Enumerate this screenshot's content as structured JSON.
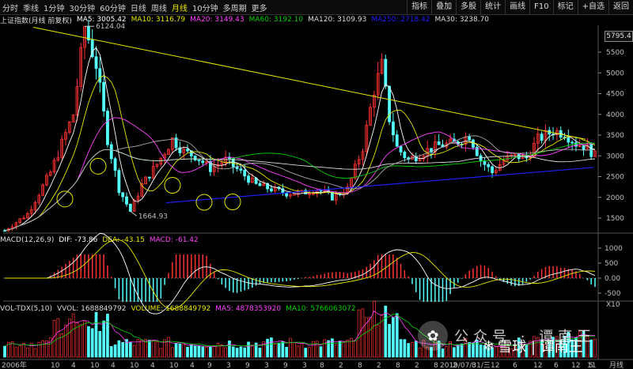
{
  "toolbar": {
    "periods": [
      "分时",
      "季线",
      "1分钟",
      "30分钟",
      "60分钟",
      "日线",
      "周线",
      "月线",
      "10分钟",
      "多周期",
      "更多"
    ],
    "active_period": "月线",
    "right_buttons": [
      "指标",
      "叠加",
      "多股",
      "统计",
      "画线",
      "F10",
      "标记",
      "+自选",
      "返回"
    ]
  },
  "price_legend": {
    "title": "上证指数(月线 前复权)",
    "items": [
      {
        "label": "MA5: 3005.42",
        "color": "#ffffff"
      },
      {
        "label": "MA10: 3116.79",
        "color": "#e8e800"
      },
      {
        "label": "MA20: 3149.43",
        "color": "#ff40ff"
      },
      {
        "label": "MA60: 3192.10",
        "color": "#00d000"
      },
      {
        "label": "MA120: 3109.93",
        "color": "#dcdcdc"
      },
      {
        "label": "MA250: 2718.42",
        "color": "#2020ff"
      },
      {
        "label": "MA30: 3238.70",
        "color": "#dcdcdc"
      }
    ]
  },
  "price_axis": {
    "badge": "5795.4",
    "ticks": [
      "5500",
      "5000",
      "4500",
      "4000",
      "3500",
      "3000",
      "2500",
      "2000",
      "1500"
    ]
  },
  "annotations": {
    "high": "6124.04",
    "low": "1664.93"
  },
  "macd_legend": {
    "title": "MACD(12,26,9)",
    "items": [
      {
        "label": "DIF: -73.86",
        "color": "#ffffff"
      },
      {
        "label": "DEA: -43.15",
        "color": "#e8e800"
      },
      {
        "label": "MACD: -61.42",
        "color": "#ff40ff"
      }
    ],
    "ticks": [
      "1000",
      "500",
      "0.00",
      "-500"
    ]
  },
  "vol_legend": {
    "title": "VOL-TDX(5,10)",
    "items": [
      {
        "label": "VVOL: 1688849792",
        "color": "#dcdcdc"
      },
      {
        "label": "VOLUME: 1688849792",
        "color": "#e8e800"
      },
      {
        "label": "MA5: 4878353920",
        "color": "#ff40ff"
      },
      {
        "label": "MA10: 5766063072",
        "color": "#00d000"
      }
    ],
    "tick": "X10"
  },
  "x_axis": {
    "labels": [
      "2006年",
      "10",
      "4",
      "10",
      "4",
      "10",
      "4",
      "10",
      "4",
      "9",
      "3",
      "9",
      "3",
      "9",
      "3",
      "8",
      "2",
      "8",
      "2",
      "8",
      "2",
      "8",
      "2",
      "8",
      "2019/07/31/三",
      "12",
      "6",
      "12",
      "6",
      "12",
      "5",
      "11"
    ],
    "period_label": "月线"
  },
  "watermark": {
    "text1": "公众号 · 谭南王",
    "text2": "雪球 | 谭南王"
  },
  "colors": {
    "up": "#ff3232",
    "down": "#54ffff",
    "trend_yellow": "#e8e800",
    "trend_blue": "#2020ff"
  }
}
